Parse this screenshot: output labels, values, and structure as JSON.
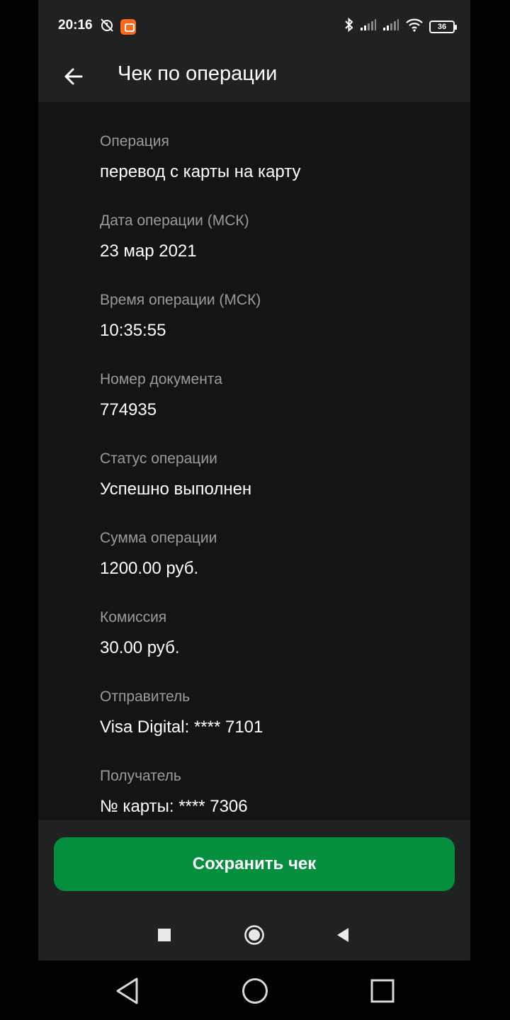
{
  "status_bar": {
    "time": "20:16",
    "icons": [
      "alarm-off-icon",
      "app-notification-icon",
      "bluetooth-icon",
      "signal-1-icon",
      "signal-2-icon",
      "wifi-icon"
    ],
    "battery": "36"
  },
  "header": {
    "back_icon": "arrow-left-icon",
    "title": "Чек по операции"
  },
  "receipt": {
    "fields": [
      {
        "label": "Операция",
        "value": "перевод с карты на карту"
      },
      {
        "label": "Дата операции (МСК)",
        "value": "23 мар 2021"
      },
      {
        "label": "Время операции (МСК)",
        "value": "10:35:55"
      },
      {
        "label": "Номер документа",
        "value": "774935"
      },
      {
        "label": "Статус операции",
        "value": "Успешно выполнен"
      },
      {
        "label": "Сумма операции",
        "value": "1200.00 руб."
      },
      {
        "label": "Комиссия",
        "value": "30.00 руб."
      },
      {
        "label": "Отправитель",
        "value": "Visa Digital: **** 7101"
      },
      {
        "label": "Получатель",
        "value": "№ карты: **** 7306"
      }
    ]
  },
  "actions": {
    "save_label": "Сохранить чек"
  },
  "colors": {
    "accent": "#038f3e",
    "background": "#141414",
    "header": "#1f2221",
    "label": "#9b9b9b"
  }
}
